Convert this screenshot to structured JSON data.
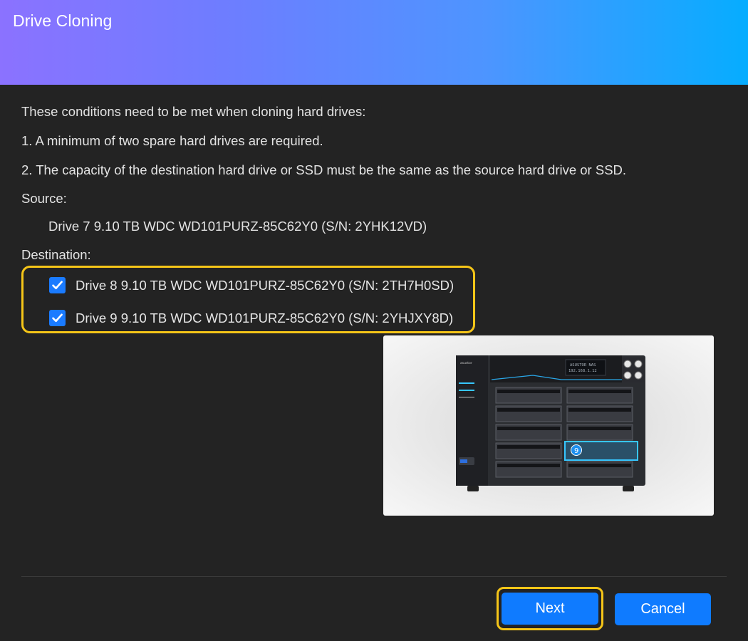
{
  "dialog": {
    "title": "Drive Cloning"
  },
  "content": {
    "intro": "These conditions need to be met when cloning hard drives:",
    "condition_1": "1. A minimum of two spare hard drives are required.",
    "condition_2": "2. The capacity of the destination hard drive or SSD must be the same as the source hard drive or SSD.",
    "source_label": "Source:",
    "source_drive": "Drive 7 9.10 TB WDC WD101PURZ-85C62Y0 (S/N: 2YHK12VD)",
    "destination_label": "Destination:",
    "destinations": [
      {
        "label": "Drive 8 9.10 TB WDC WD101PURZ-85C62Y0 (S/N: 2TH7H0SD)",
        "checked": true
      },
      {
        "label": "Drive 9 9.10 TB WDC WD101PURZ-85C62Y0 (S/N: 2YHJXY8D)",
        "checked": true
      }
    ]
  },
  "illustration": {
    "lcd_line1": "ASUSTOR NAS",
    "lcd_line2": "192.168.1.12",
    "brand": "asustor",
    "highlight_bay": "9"
  },
  "footer": {
    "next_label": "Next",
    "cancel_label": "Cancel"
  },
  "colors": {
    "accent": "#0f7bff",
    "highlight": "#f5c518",
    "background": "#232323",
    "header_start": "#8b72ff",
    "header_end": "#06adff"
  }
}
